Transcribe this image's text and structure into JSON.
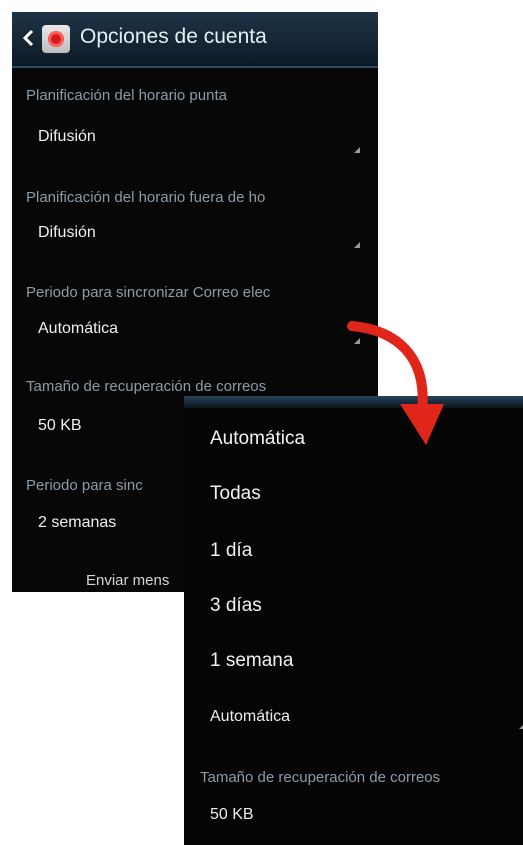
{
  "header": {
    "title": "Opciones de cuenta"
  },
  "settings": [
    {
      "label": "Planificación del horario punta",
      "value": "Difusión"
    },
    {
      "label": "Planificación del horario fuera de ho",
      "value": "Difusión"
    },
    {
      "label": "Periodo para sincronizar Correo elec",
      "value": "Automática"
    },
    {
      "label": "Tamaño de recuperación de correos",
      "value": "50 KB"
    },
    {
      "label": "Periodo para sinc",
      "value": "2 semanas"
    }
  ],
  "footer": {
    "send_label": "Enviar mens"
  },
  "popup": {
    "options": [
      "Automática",
      "Todas",
      "1 día",
      "3 días",
      "1 semana"
    ],
    "current_value": "Automática",
    "size_label": "Tamaño de recuperación de correos",
    "size_value": "50 KB"
  },
  "colors": {
    "accent_arrow": "#e0261b",
    "header_bg": "#1f3447"
  },
  "icons": [
    "back-chevron-icon",
    "email-app-icon",
    "dropdown-corner-icon",
    "curved-arrow-icon"
  ]
}
